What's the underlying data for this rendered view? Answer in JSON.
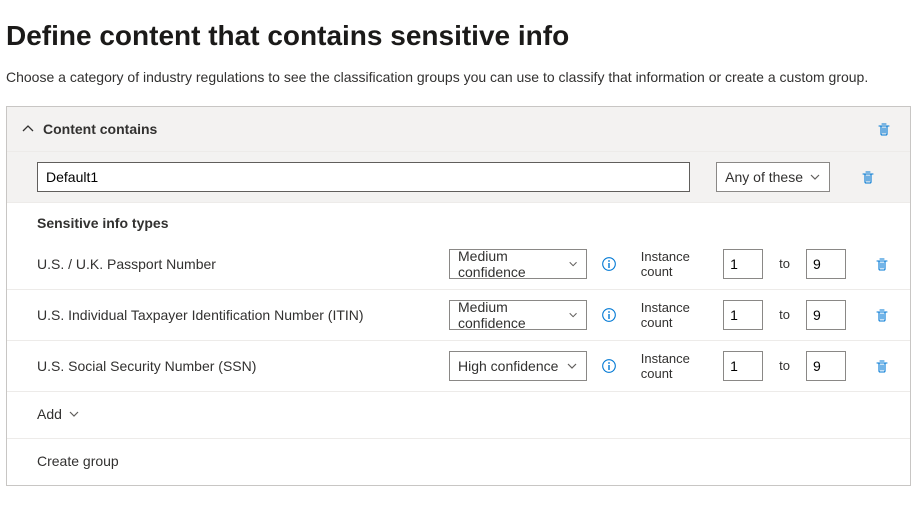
{
  "header": {
    "title": "Define content that contains sensitive info",
    "description": "Choose a category of industry regulations to see the classification groups you can use to classify that information or create a custom group."
  },
  "panel": {
    "section_title": "Content contains",
    "group_name": "Default1",
    "match_mode": "Any of these",
    "sub_title": "Sensitive info types",
    "instance_label": "Instance count",
    "to_label": "to",
    "rows": [
      {
        "label": "U.S. / U.K. Passport Number",
        "confidence": "Medium confidence",
        "min": "1",
        "max": "9"
      },
      {
        "label": "U.S. Individual Taxpayer Identification Number (ITIN)",
        "confidence": "Medium confidence",
        "min": "1",
        "max": "9"
      },
      {
        "label": "U.S. Social Security Number (SSN)",
        "confidence": "High confidence",
        "min": "1",
        "max": "9"
      }
    ],
    "add_label": "Add",
    "create_group_label": "Create group"
  }
}
